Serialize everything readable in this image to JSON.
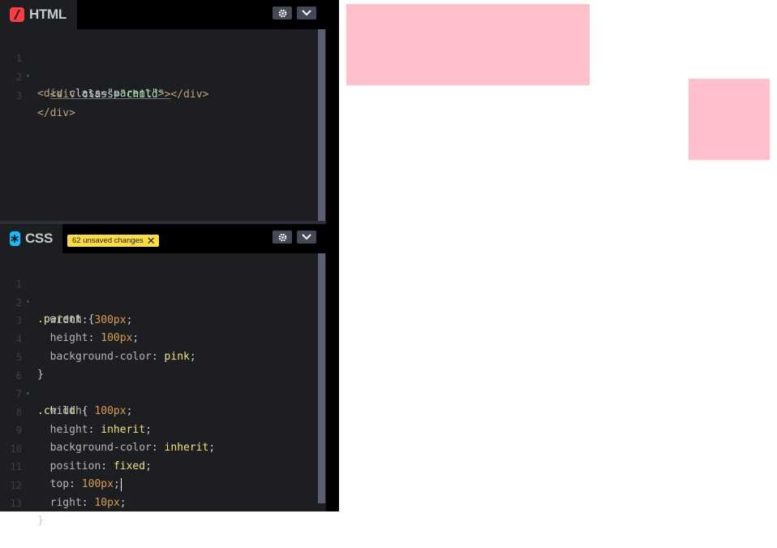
{
  "html_panel": {
    "title": "HTML",
    "lines": [
      {
        "n": "1",
        "fold": "▾"
      },
      {
        "n": "2",
        "fold": ""
      },
      {
        "n": "3",
        "fold": ""
      }
    ],
    "code": {
      "l1_open": "<div ",
      "l1_attr": "class",
      "l1_eq": "=",
      "l1_val": "\"parent\"",
      "l1_close": ">",
      "l2_indent": "  ",
      "l2_open": "<div ",
      "l2_attr": "class",
      "l2_eq": "=",
      "l2_val": "\"child\"",
      "l2_close": "></div>",
      "l3": "</div>"
    }
  },
  "css_panel": {
    "title": "CSS",
    "badge": "62 unsaved changes",
    "badge_close": "✕",
    "lines": [
      {
        "n": "1",
        "fold": "▾"
      },
      {
        "n": "2",
        "fold": ""
      },
      {
        "n": "3",
        "fold": ""
      },
      {
        "n": "4",
        "fold": ""
      },
      {
        "n": "5",
        "fold": ""
      },
      {
        "n": "6",
        "fold": "▾"
      },
      {
        "n": "7",
        "fold": ""
      },
      {
        "n": "8",
        "fold": ""
      },
      {
        "n": "9",
        "fold": ""
      },
      {
        "n": "10",
        "fold": ""
      },
      {
        "n": "11",
        "fold": ""
      },
      {
        "n": "12",
        "fold": ""
      },
      {
        "n": "13",
        "fold": ""
      }
    ],
    "code": {
      "parent_sel": ".parent",
      "open": " {",
      "width": "width",
      "width_val": "300px",
      "height": "height",
      "height_val": "100px",
      "bg": "background-color",
      "bg_val": "pink",
      "close": "}",
      "child_sel": ".child",
      "c_width": "width",
      "c_width_val": "100px",
      "c_height": "height",
      "c_height_val": "inherit",
      "c_bg": "background-color",
      "c_bg_val": "inherit",
      "pos": "position",
      "pos_val": "fixed",
      "top": "top",
      "top_val": "100px",
      "right": "right",
      "right_val": "10px",
      "colon": ": ",
      "semi": ";"
    }
  },
  "icons": {
    "html_icon": "slash-icon",
    "css_icon": "asterisk-icon",
    "settings": "gear-icon",
    "collapse": "chevron-down-icon"
  },
  "colors": {
    "html_icon_bg": "#ff3c41",
    "css_icon_bg": "#0ebeff",
    "badge_bg": "#ffdd40",
    "preview_box": "pink"
  }
}
